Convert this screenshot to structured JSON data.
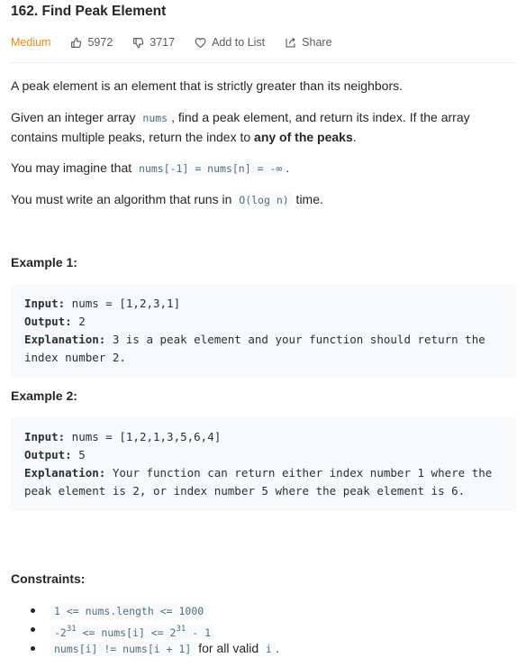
{
  "problem": {
    "title": "162. Find Peak Element",
    "difficulty": "Medium",
    "likes": "5972",
    "dislikes": "3717",
    "add_to_list": "Add to List",
    "share": "Share"
  },
  "description": {
    "p1": "A peak element is an element that is strictly greater than its neighbors.",
    "p2_a": "Given an integer array ",
    "p2_code": "nums",
    "p2_b": ", find a peak element, and return its index. If the array contains multiple peaks, return the index to ",
    "p2_bold": "any of the peaks",
    "p2_c": ".",
    "p3_a": "You may imagine that ",
    "p3_code": "nums[-1] = nums[n] = -∞",
    "p3_b": ".",
    "p4_a": "You must write an algorithm that runs in ",
    "p4_code": "O(log n)",
    "p4_b": " time."
  },
  "examples": [
    {
      "title": "Example 1:",
      "input_label": "Input:",
      "input": " nums = [1,2,3,1]",
      "output_label": "Output:",
      "output": " 2",
      "explanation_label": "Explanation:",
      "explanation": " 3 is a peak element and your function should return the index number 2."
    },
    {
      "title": "Example 2:",
      "input_label": "Input:",
      "input": " nums = [1,2,1,3,5,6,4]",
      "output_label": "Output:",
      "output": " 5",
      "explanation_label": "Explanation:",
      "explanation": " Your function can return either index number 1 where the peak element is 2, or index number 5 where the peak element is 6."
    }
  ],
  "constraints": {
    "title": "Constraints:",
    "c1": "1 <= nums.length <= 1000",
    "c2_a": "-2",
    "c2_sup1": "31",
    "c2_b": " <= nums[i] <= 2",
    "c2_sup2": "31",
    "c2_c": " - 1",
    "c3_code": "nums[i] != nums[i + 1]",
    "c3_text": " for all valid ",
    "c3_code2": "i",
    "c3_end": "."
  },
  "colors": {
    "difficulty_medium": "#ef8a12",
    "code_bg": "#f7f9fa",
    "text": "#262626"
  },
  "icons": [
    "thumbs-up-icon",
    "thumbs-down-icon",
    "heart-icon",
    "share-icon"
  ]
}
